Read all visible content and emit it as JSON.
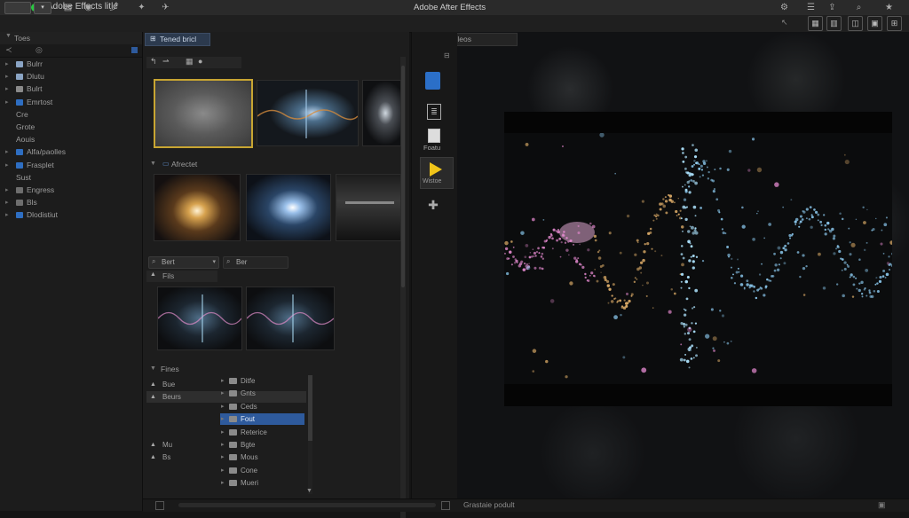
{
  "window": {
    "title_left": "Adobe Effects litle",
    "title_center": "Adobe After Effects"
  },
  "colors": {
    "close": "#ff5f57",
    "minimize": "#febc2e",
    "zoom": "#28c840",
    "accent": "#2e5a9c",
    "selected_frame": "#c8a532",
    "play": "#f0c419"
  },
  "icons": {
    "project_tree": "list-icon",
    "target": "target-icon",
    "export": "export-icon",
    "star": "star-icon",
    "settings": "gear-icon",
    "share": "share-icon",
    "bookmark": "bookmark-icon",
    "search": "search-icon",
    "pin": "pin-icon",
    "play": "play-icon",
    "add": "plus-icon"
  },
  "left_panel": {
    "header": "Toes",
    "rows": [
      {
        "label": "Bulrr",
        "kind": "folder"
      },
      {
        "label": "Dlutu",
        "kind": "folder"
      },
      {
        "label": "Bulrt",
        "kind": "file"
      },
      {
        "label": "Emrtost",
        "kind": "blue"
      },
      {
        "label": "Cre",
        "kind": "none"
      },
      {
        "label": "Grote",
        "kind": "none"
      },
      {
        "label": "Aouis",
        "kind": "none"
      },
      {
        "label": "Alfa/paolles",
        "kind": "blue"
      },
      {
        "label": "Frasplet",
        "kind": "blue"
      },
      {
        "label": "Sust",
        "kind": "none"
      },
      {
        "label": "Engress",
        "kind": "gray"
      },
      {
        "label": "Bls",
        "kind": "gray"
      },
      {
        "label": "Dlodistiut",
        "kind": "blue"
      }
    ]
  },
  "middle_panel": {
    "tab_label": "Tened bricl",
    "section_abstract": "Afrectet",
    "filter1_value": "Bert",
    "filter2_value": "Ber",
    "section_fils": "Fils",
    "section_fires": "Fines",
    "left_list": [
      "Bue",
      "Beurs",
      "Mu",
      "Bs"
    ],
    "right_list": [
      "Ditfe",
      "Gnts",
      "Ceds",
      "Fout",
      "Reterice",
      "Bgte",
      "Mous",
      "Cone",
      "Mueri"
    ],
    "right_list_selected_index": 3
  },
  "tool_column": {
    "labels": [
      "Foatu",
      "Wistoe"
    ]
  },
  "viewer": {
    "tab_label": "Marfare lileos"
  },
  "status_bar": {
    "label": "Grastaie podult"
  }
}
